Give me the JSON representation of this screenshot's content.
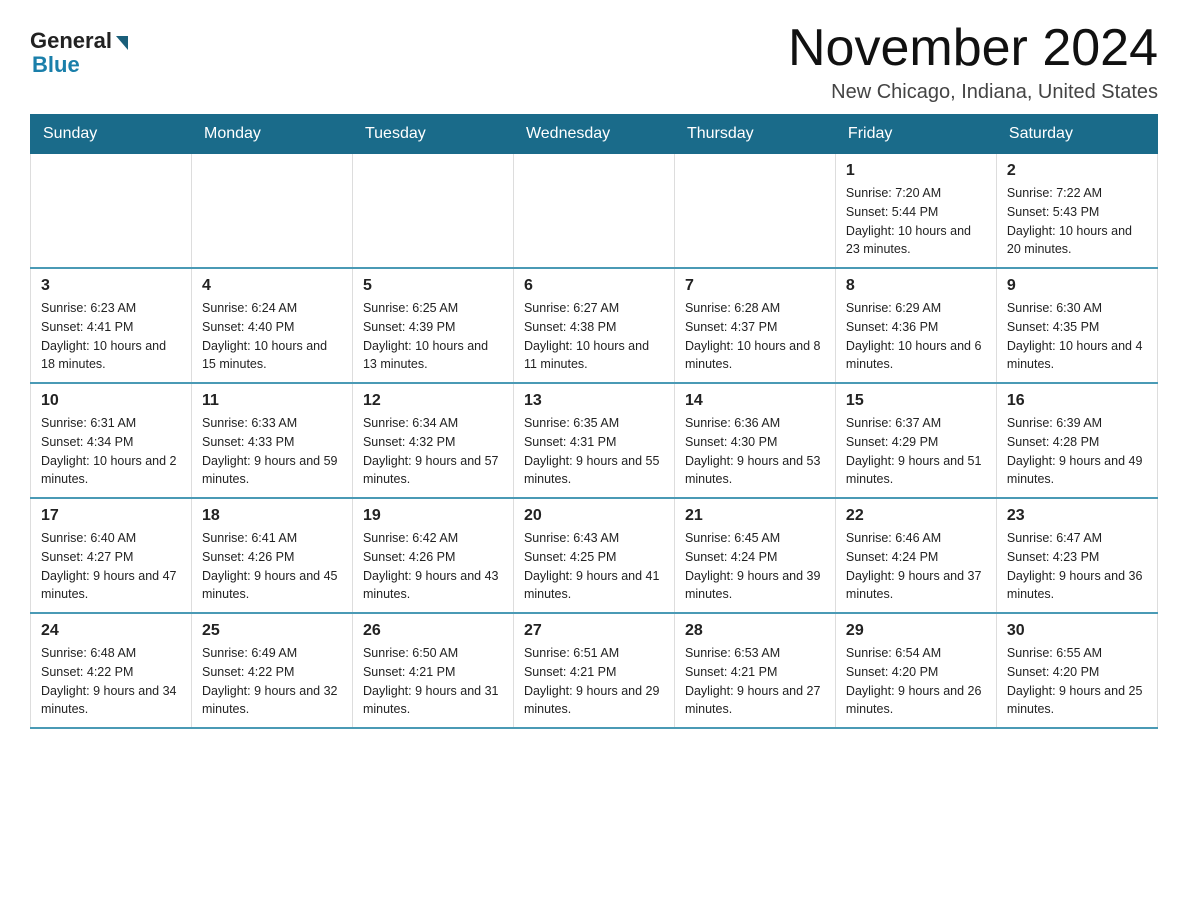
{
  "logo": {
    "general": "General",
    "blue": "Blue"
  },
  "title": "November 2024",
  "location": "New Chicago, Indiana, United States",
  "weekdays": [
    "Sunday",
    "Monday",
    "Tuesday",
    "Wednesday",
    "Thursday",
    "Friday",
    "Saturday"
  ],
  "weeks": [
    [
      {
        "day": "",
        "info": ""
      },
      {
        "day": "",
        "info": ""
      },
      {
        "day": "",
        "info": ""
      },
      {
        "day": "",
        "info": ""
      },
      {
        "day": "",
        "info": ""
      },
      {
        "day": "1",
        "info": "Sunrise: 7:20 AM\nSunset: 5:44 PM\nDaylight: 10 hours and 23 minutes."
      },
      {
        "day": "2",
        "info": "Sunrise: 7:22 AM\nSunset: 5:43 PM\nDaylight: 10 hours and 20 minutes."
      }
    ],
    [
      {
        "day": "3",
        "info": "Sunrise: 6:23 AM\nSunset: 4:41 PM\nDaylight: 10 hours and 18 minutes."
      },
      {
        "day": "4",
        "info": "Sunrise: 6:24 AM\nSunset: 4:40 PM\nDaylight: 10 hours and 15 minutes."
      },
      {
        "day": "5",
        "info": "Sunrise: 6:25 AM\nSunset: 4:39 PM\nDaylight: 10 hours and 13 minutes."
      },
      {
        "day": "6",
        "info": "Sunrise: 6:27 AM\nSunset: 4:38 PM\nDaylight: 10 hours and 11 minutes."
      },
      {
        "day": "7",
        "info": "Sunrise: 6:28 AM\nSunset: 4:37 PM\nDaylight: 10 hours and 8 minutes."
      },
      {
        "day": "8",
        "info": "Sunrise: 6:29 AM\nSunset: 4:36 PM\nDaylight: 10 hours and 6 minutes."
      },
      {
        "day": "9",
        "info": "Sunrise: 6:30 AM\nSunset: 4:35 PM\nDaylight: 10 hours and 4 minutes."
      }
    ],
    [
      {
        "day": "10",
        "info": "Sunrise: 6:31 AM\nSunset: 4:34 PM\nDaylight: 10 hours and 2 minutes."
      },
      {
        "day": "11",
        "info": "Sunrise: 6:33 AM\nSunset: 4:33 PM\nDaylight: 9 hours and 59 minutes."
      },
      {
        "day": "12",
        "info": "Sunrise: 6:34 AM\nSunset: 4:32 PM\nDaylight: 9 hours and 57 minutes."
      },
      {
        "day": "13",
        "info": "Sunrise: 6:35 AM\nSunset: 4:31 PM\nDaylight: 9 hours and 55 minutes."
      },
      {
        "day": "14",
        "info": "Sunrise: 6:36 AM\nSunset: 4:30 PM\nDaylight: 9 hours and 53 minutes."
      },
      {
        "day": "15",
        "info": "Sunrise: 6:37 AM\nSunset: 4:29 PM\nDaylight: 9 hours and 51 minutes."
      },
      {
        "day": "16",
        "info": "Sunrise: 6:39 AM\nSunset: 4:28 PM\nDaylight: 9 hours and 49 minutes."
      }
    ],
    [
      {
        "day": "17",
        "info": "Sunrise: 6:40 AM\nSunset: 4:27 PM\nDaylight: 9 hours and 47 minutes."
      },
      {
        "day": "18",
        "info": "Sunrise: 6:41 AM\nSunset: 4:26 PM\nDaylight: 9 hours and 45 minutes."
      },
      {
        "day": "19",
        "info": "Sunrise: 6:42 AM\nSunset: 4:26 PM\nDaylight: 9 hours and 43 minutes."
      },
      {
        "day": "20",
        "info": "Sunrise: 6:43 AM\nSunset: 4:25 PM\nDaylight: 9 hours and 41 minutes."
      },
      {
        "day": "21",
        "info": "Sunrise: 6:45 AM\nSunset: 4:24 PM\nDaylight: 9 hours and 39 minutes."
      },
      {
        "day": "22",
        "info": "Sunrise: 6:46 AM\nSunset: 4:24 PM\nDaylight: 9 hours and 37 minutes."
      },
      {
        "day": "23",
        "info": "Sunrise: 6:47 AM\nSunset: 4:23 PM\nDaylight: 9 hours and 36 minutes."
      }
    ],
    [
      {
        "day": "24",
        "info": "Sunrise: 6:48 AM\nSunset: 4:22 PM\nDaylight: 9 hours and 34 minutes."
      },
      {
        "day": "25",
        "info": "Sunrise: 6:49 AM\nSunset: 4:22 PM\nDaylight: 9 hours and 32 minutes."
      },
      {
        "day": "26",
        "info": "Sunrise: 6:50 AM\nSunset: 4:21 PM\nDaylight: 9 hours and 31 minutes."
      },
      {
        "day": "27",
        "info": "Sunrise: 6:51 AM\nSunset: 4:21 PM\nDaylight: 9 hours and 29 minutes."
      },
      {
        "day": "28",
        "info": "Sunrise: 6:53 AM\nSunset: 4:21 PM\nDaylight: 9 hours and 27 minutes."
      },
      {
        "day": "29",
        "info": "Sunrise: 6:54 AM\nSunset: 4:20 PM\nDaylight: 9 hours and 26 minutes."
      },
      {
        "day": "30",
        "info": "Sunrise: 6:55 AM\nSunset: 4:20 PM\nDaylight: 9 hours and 25 minutes."
      }
    ]
  ]
}
